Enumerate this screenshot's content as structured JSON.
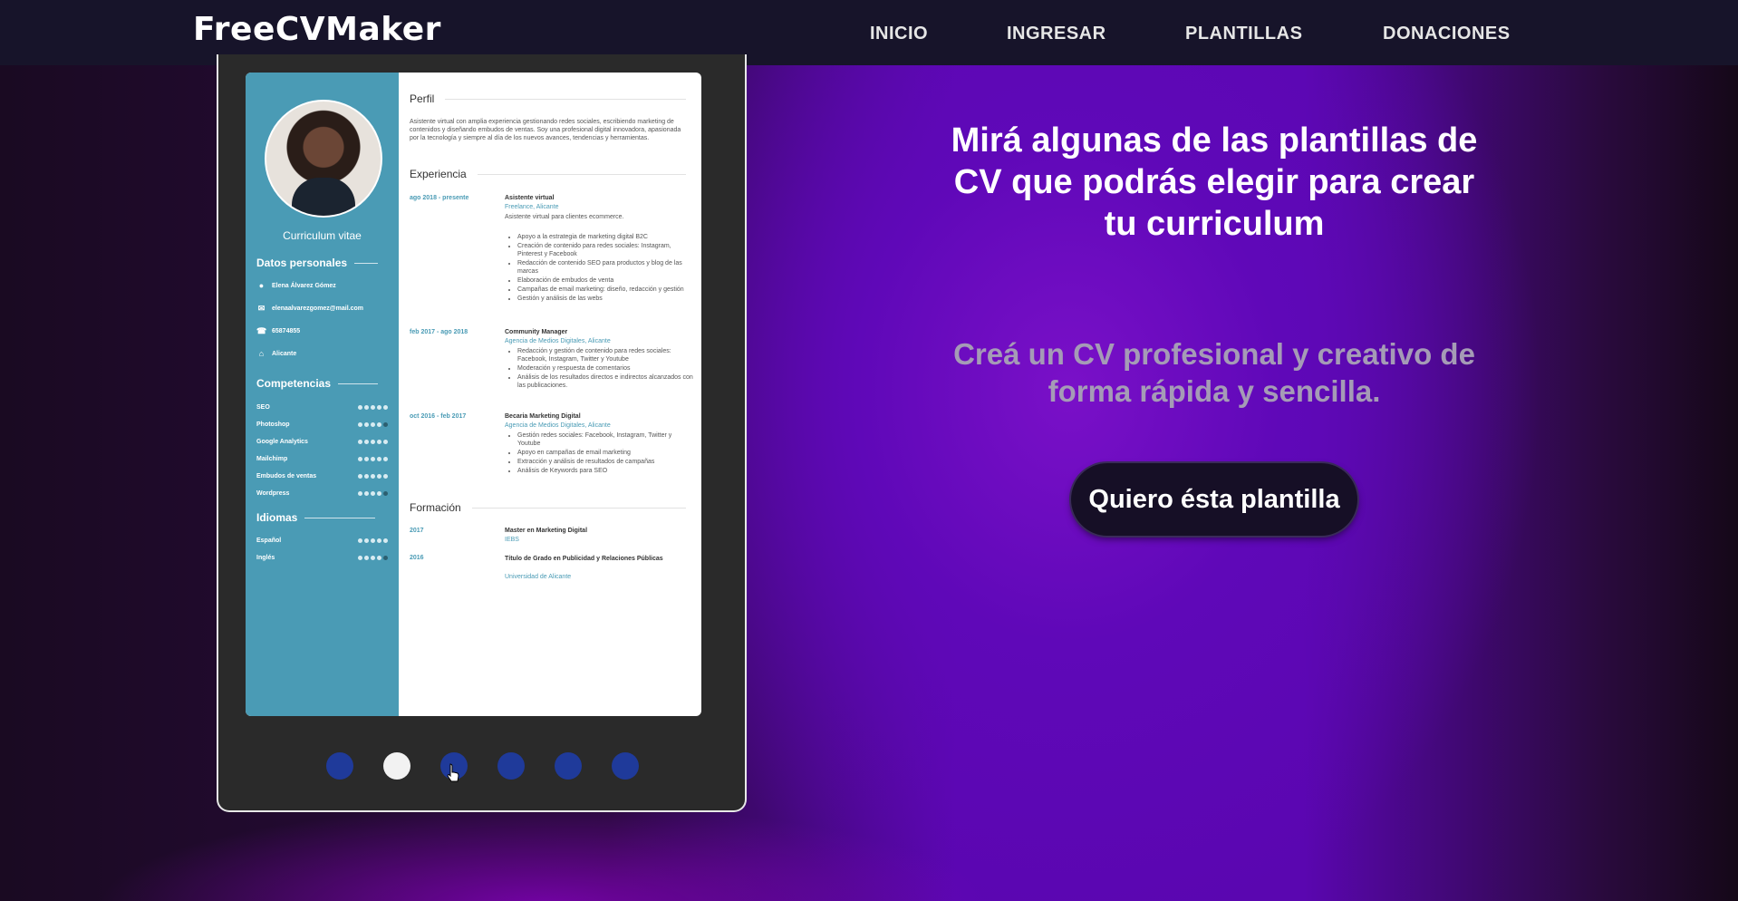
{
  "nav": {
    "logo": "FreeCVMaker",
    "items": [
      "INICIO",
      "INGRESAR",
      "PLANTILLAS",
      "DONACIONES"
    ]
  },
  "hero": {
    "headline": "Mirá algunas de las plantillas de CV que podrás elegir para crear tu curriculum",
    "subtitle": "Creá un CV profesional y creativo de forma rápida y sencilla.",
    "cta": "Quiero ésta plantilla"
  },
  "carousel": {
    "active_index": 1,
    "dot_count": 6
  },
  "cv": {
    "side_title": "Curriculum vitae",
    "personal_heading": "Datos personales",
    "personal": [
      "Elena Álvarez Gómez",
      "elenaalvarezgomez@mail.com",
      "65874855",
      "Alicante"
    ],
    "skills_heading": "Competencias",
    "skills": [
      {
        "name": "SEO",
        "level": 5
      },
      {
        "name": "Photoshop",
        "level": 4
      },
      {
        "name": "Google Analytics",
        "level": 5
      },
      {
        "name": "Mailchimp",
        "level": 5
      },
      {
        "name": "Embudos de ventas",
        "level": 5
      },
      {
        "name": "Wordpress",
        "level": 4
      }
    ],
    "languages_heading": "Idiomas",
    "languages": [
      {
        "name": "Español",
        "level": 5
      },
      {
        "name": "Inglés",
        "level": 4
      }
    ],
    "profile_heading": "Perfil",
    "profile": "Asistente virtual con amplia experiencia gestionando redes sociales, escribiendo marketing de contenidos y diseñando embudos de ventas. Soy una profesional digital innovadora, apasionada por la tecnología y siempre al día de los nuevos avances, tendencias y herramientas.",
    "experience_heading": "Experiencia",
    "jobs": [
      {
        "date": "ago 2018 - presente",
        "title": "Asistente virtual",
        "company": "Freelance, Alicante",
        "desc": "Asistente virtual para clientes ecommerce.",
        "bullets": [
          "Apoyo a la estrategia de marketing digital B2C",
          "Creación de contenido para redes sociales: Instagram, Pinterest y Facebook",
          "Redacción de contenido SEO para productos y blog de las marcas",
          "Elaboración de embudos de venta",
          "Campañas de email marketing: diseño, redacción y gestión",
          "Gestión y análisis de las webs"
        ]
      },
      {
        "date": "feb 2017 - ago 2018",
        "title": "Community Manager",
        "company": "Agencia de Medios Digitales, Alicante",
        "bullets": [
          "Redacción y gestión de contenido para redes sociales: Facebook, Instagram, Twitter y Youtube",
          "Moderación y respuesta de comentarios",
          "Análisis de los resultados directos e indirectos alcanzados con las publicaciones."
        ]
      },
      {
        "date": "oct 2016 - feb 2017",
        "title": "Becaria Marketing Digital",
        "company": "Agencia de Medios Digitales, Alicante",
        "bullets": [
          "Gestión redes sociales: Facebook, Instagram, Twitter y Youtube",
          "Apoyo en campañas de email marketing",
          "Extracción y análisis de resultados de campañas",
          "Análisis de Keywords para SEO"
        ]
      }
    ],
    "education_heading": "Formación",
    "education": [
      {
        "date": "2017",
        "title": "Master en Marketing Digital",
        "school": "IEBS"
      },
      {
        "date": "2016",
        "title": "Título de Grado en Publicidad y Relaciones Públicas",
        "school": "Universidad de Alicante"
      }
    ]
  }
}
